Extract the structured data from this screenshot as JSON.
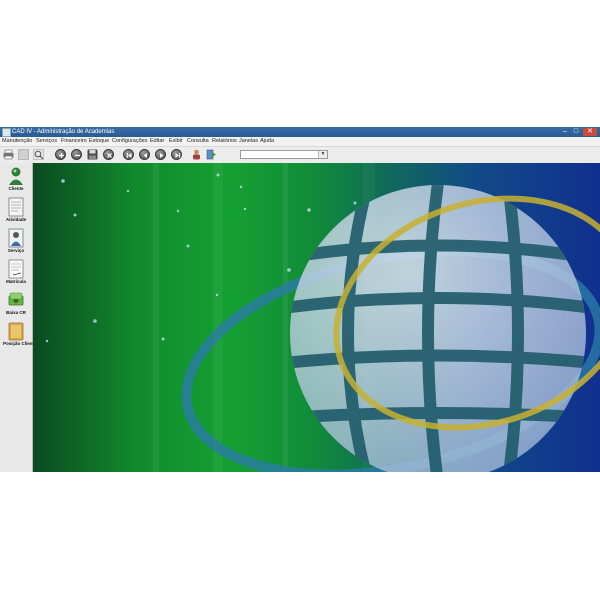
{
  "window": {
    "title": "CAD IV - Administração de Academias"
  },
  "menu": [
    "Manutenção",
    "Serviços",
    "Financeiro",
    "Estoque",
    "Configurações",
    "Editar",
    "Exibir",
    "Consulta",
    "Relatórios",
    "Janelas",
    "Ajuda"
  ],
  "toolbar": {
    "buttons": [
      "printer-icon",
      "blank-icon",
      "zoom-icon",
      "add-icon",
      "remove-icon",
      "save-icon",
      "cancel-icon",
      "first-icon",
      "prev-icon",
      "next-icon",
      "last-icon",
      "user-icon",
      "exit-icon"
    ],
    "combo_value": ""
  },
  "sidebar": {
    "items": [
      {
        "label": "Cliente",
        "icon": "client-icon"
      },
      {
        "label": "Atividade",
        "icon": "activity-icon"
      },
      {
        "label": "Serviço",
        "icon": "service-icon"
      },
      {
        "label": "Matrícula",
        "icon": "enrollment-icon"
      },
      {
        "label": "Baixa CR",
        "icon": "money-icon"
      },
      {
        "label": "Posição Cliente",
        "icon": "folder-icon"
      }
    ]
  },
  "colors": {
    "titlebar": "#3a6ea5",
    "globe": "#b8c8e0",
    "ring": "#c8b030",
    "orbit": "#2a7aa8"
  }
}
